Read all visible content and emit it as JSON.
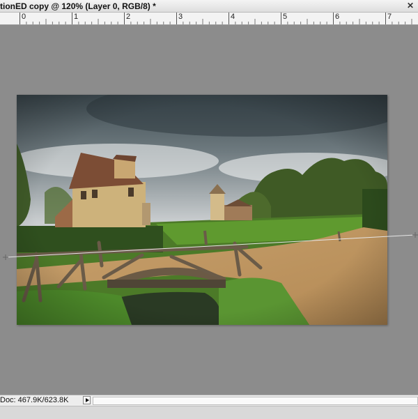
{
  "window": {
    "title": "tionED copy @ 120% (Layer 0, RGB/8) *",
    "close_glyph": "✕"
  },
  "ruler": {
    "labels": [
      "0",
      "1",
      "2",
      "3",
      "4",
      "5",
      "6",
      "7"
    ]
  },
  "status": {
    "doc_info": "Doc: 467.9K/623.8K"
  },
  "colors": {
    "workspace": "#8c8c8c",
    "ruler_bg": "#f3f3f3",
    "guide_line": "#d8d8d8"
  }
}
